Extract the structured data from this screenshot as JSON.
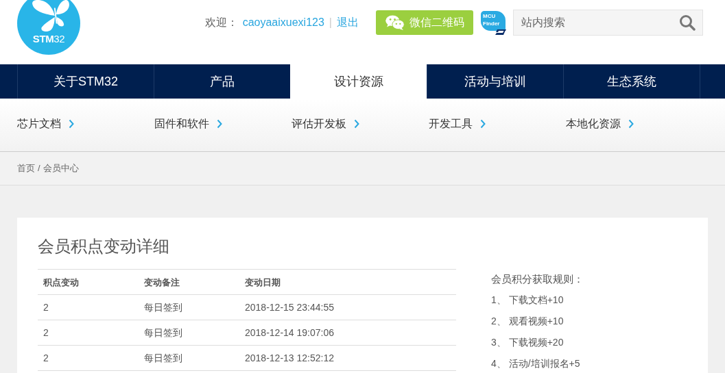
{
  "header": {
    "logo": {
      "text": "**STM**32"
    },
    "welcome": {
      "label": "欢迎：",
      "username": "caoyaaixuexi123",
      "separator": "|",
      "logout": "退出"
    },
    "wechat_button": {
      "label": "微信二维码"
    },
    "finder_badge": {
      "line_1": "MCU",
      "line_2": "Finder"
    },
    "search": {
      "placeholder": "站内搜索"
    }
  },
  "nav": {
    "items": [
      {
        "label": "关于STM32",
        "selected": false
      },
      {
        "label": "产品",
        "selected": false
      },
      {
        "label": "设计资源",
        "selected": true
      },
      {
        "label": "活动与培训",
        "selected": false
      },
      {
        "label": "生态系统",
        "selected": false
      }
    ]
  },
  "subnav": {
    "items": [
      "芯片文档",
      "固件和软件",
      "评估开发板",
      "开发工具",
      "本地化资源"
    ]
  },
  "breadcrumb": {
    "items": [
      "首页",
      "会员中心"
    ],
    "separator": "/"
  },
  "card": {
    "title": "会员积点变动详细",
    "table": {
      "columns": [
        "积点变动",
        "变动备注",
        "变动日期"
      ],
      "rows": [
        [
          "2",
          "每日签到",
          "2018-12-15 23:44:55"
        ],
        [
          "2",
          "每日签到",
          "2018-12-14 19:07:06"
        ],
        [
          "2",
          "每日签到",
          "2018-12-13 12:52:12"
        ]
      ]
    },
    "rules": {
      "title": "会员积分获取规则：",
      "items": [
        "1、 下载文档+10",
        "2、 观看视频+10",
        "3、 下载视频+20",
        "4、 活动/培训报名+5"
      ]
    }
  }
}
